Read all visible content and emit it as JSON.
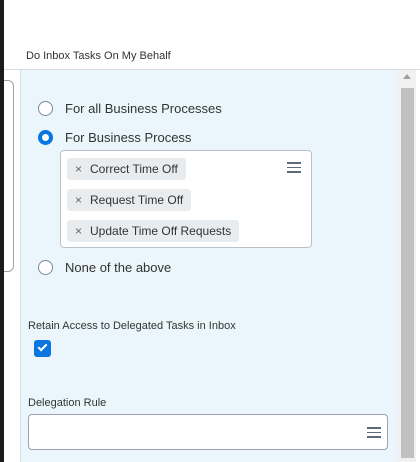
{
  "header": {
    "title": "Do Inbox Tasks On My Behalf"
  },
  "options": [
    {
      "label": "For all Business Processes",
      "checked": false
    },
    {
      "label": "For Business Process",
      "checked": true
    },
    {
      "label": "None of the above",
      "checked": false
    }
  ],
  "business_processes": {
    "selected": [
      {
        "label": "Correct Time Off"
      },
      {
        "label": "Request Time Off"
      },
      {
        "label": "Update Time Off Requests"
      }
    ],
    "remove_glyph": "×"
  },
  "retain_access": {
    "label": "Retain Access to Delegated Tasks in Inbox",
    "checked": true
  },
  "delegation_rule": {
    "label": "Delegation Rule",
    "value": ""
  },
  "colors": {
    "accent": "#0875e1",
    "panel_bg": "#eaf6fb"
  },
  "icons": {
    "prompt_list": "list-icon",
    "rule_list": "list-icon",
    "checkbox_tick": "check-icon",
    "scroll_up": "arrow-up-icon"
  }
}
